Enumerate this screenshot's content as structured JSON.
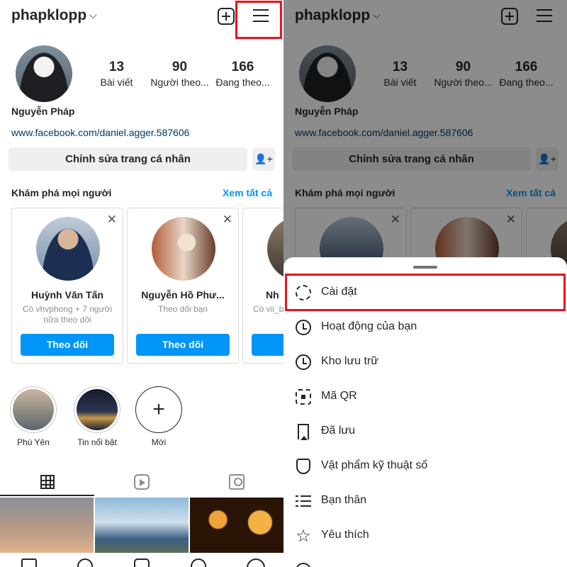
{
  "profile": {
    "username": "phapklopp",
    "full_name": "Nguyễn Pháp",
    "link": "www.facebook.com/daniel.agger.587606",
    "stats": [
      {
        "value": "13",
        "label": "Bài viết"
      },
      {
        "value": "90",
        "label": "Người theo..."
      },
      {
        "value": "166",
        "label": "Đang theo..."
      }
    ],
    "edit_label": "Chỉnh sửa trang cá nhân"
  },
  "discover": {
    "title": "Khám phá mọi người",
    "see_all": "Xem tất cả",
    "cards": [
      {
        "name": "Huỳnh Văn Tấn",
        "sub": "Có vhvphong + 7 người nữa theo dõi",
        "button": "Theo dõi"
      },
      {
        "name": "Nguyễn Hồ Phư...",
        "sub": "Theo dõi bạn",
        "button": "Theo dõi"
      },
      {
        "name": "Nh",
        "sub": "Có vii_b",
        "button": "T"
      }
    ]
  },
  "highlights": [
    {
      "label": "Phú Yên"
    },
    {
      "label": "Tin nổi bật"
    },
    {
      "label": "Mới"
    }
  ],
  "sheet": {
    "items": [
      {
        "label": "Cài đặt",
        "icon": "gear-icon"
      },
      {
        "label": "Hoạt động của bạn",
        "icon": "activity-icon"
      },
      {
        "label": "Kho lưu trữ",
        "icon": "archive-icon"
      },
      {
        "label": "Mã QR",
        "icon": "qr-icon"
      },
      {
        "label": "Đã lưu",
        "icon": "bookmark-icon"
      },
      {
        "label": "Vật phẩm kỹ thuật số",
        "icon": "shield-icon"
      },
      {
        "label": "Bạn thân",
        "icon": "close-friends-icon"
      },
      {
        "label": "Yêu thích",
        "icon": "star-icon"
      }
    ]
  },
  "colors": {
    "accent": "#0095f6",
    "highlight_box": "#e8151b"
  }
}
